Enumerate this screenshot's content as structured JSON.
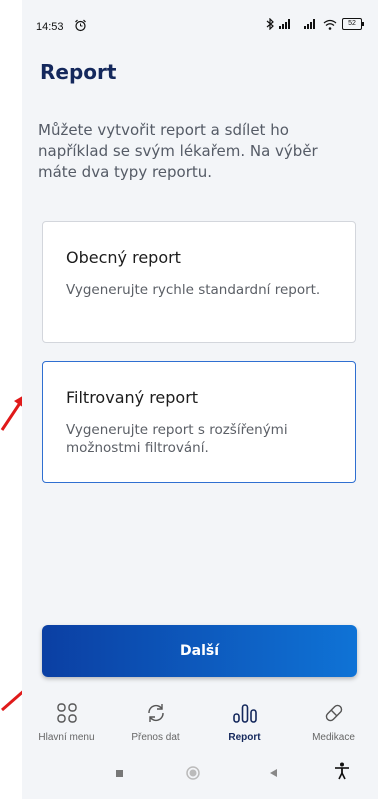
{
  "status_bar": {
    "time": "14:53",
    "battery": "52"
  },
  "header": {
    "title": "Report"
  },
  "intro": "Můžete vytvořit report a sdílet ho například se svým lékařem. Na výběr máte dva typy reportu.",
  "cards": [
    {
      "title": "Obecný report",
      "description": "Vygenerujte rychle standardní report."
    },
    {
      "title": "Filtrovaný report",
      "description": "Vygenerujte report s rozšířenými možnostmi filtrování."
    }
  ],
  "next_button": "Další",
  "bottom_nav": [
    {
      "label": "Hlavní menu",
      "icon": "grid-icon"
    },
    {
      "label": "Přenos dat",
      "icon": "sync-icon"
    },
    {
      "label": "Report",
      "icon": "report-icon",
      "active": true
    },
    {
      "label": "Medikace",
      "icon": "pill-icon"
    }
  ],
  "colors": {
    "accent": "#14285c",
    "button_start": "#0b3fa3",
    "button_end": "#0f73d6",
    "selected_border": "#2f6fd1",
    "annotation_arrow": "#e01a1a"
  }
}
